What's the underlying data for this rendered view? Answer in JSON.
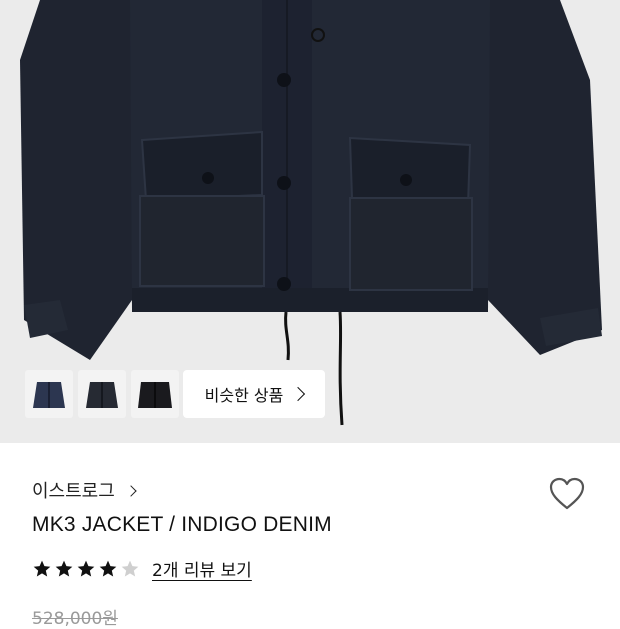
{
  "product": {
    "brand": "이스트로그",
    "title": "MK3 JACKET / INDIGO DENIM",
    "rating": 4,
    "rating_max": 5,
    "review_link": "2개 리뷰 보기",
    "original_price": "528,000원"
  },
  "gallery": {
    "thumbnails": [
      "jacket-front-thumb",
      "jacket-angle-thumb",
      "jacket-black-thumb"
    ],
    "similar_button": "비슷한 상품"
  },
  "colors": {
    "star_filled": "#111111",
    "star_empty": "#cfcfcf",
    "image_bg": "#ebebeb"
  }
}
